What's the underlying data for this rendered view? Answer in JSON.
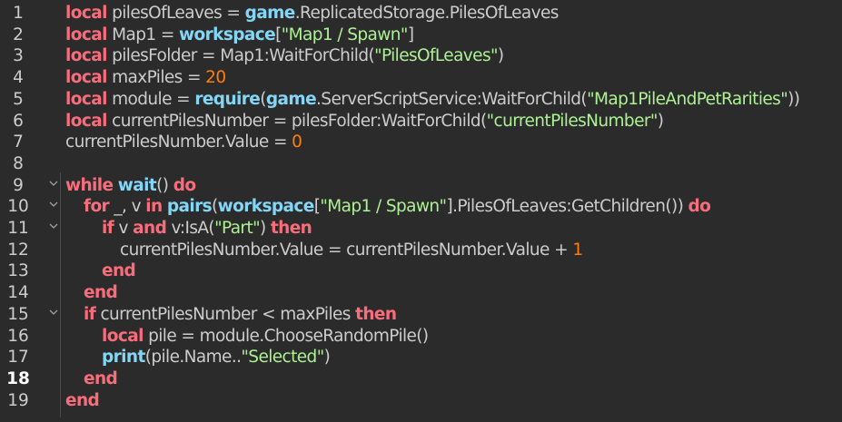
{
  "editor": {
    "current_line": 18,
    "colors": {
      "background": "#2b2b2b",
      "keyword": "#f86d7c",
      "builtin": "#84d6f7",
      "string": "#adf195",
      "number": "#ff7d0e",
      "text": "#cccccc"
    },
    "fold_icon": "chevron-down-icon",
    "lines": [
      {
        "num": "1",
        "indent": 0,
        "tokens": [
          [
            "kw",
            "local"
          ],
          [
            "id",
            " pilesOfLeaves = "
          ],
          [
            "bi",
            "game"
          ],
          [
            "id",
            ".ReplicatedStorage.PilesOfLeaves"
          ]
        ]
      },
      {
        "num": "2",
        "indent": 0,
        "tokens": [
          [
            "kw",
            "local"
          ],
          [
            "id",
            " Map1 = "
          ],
          [
            "bi",
            "workspace"
          ],
          [
            "id",
            "["
          ],
          [
            "str",
            "\"Map1 / Spawn\""
          ],
          [
            "id",
            "]"
          ]
        ]
      },
      {
        "num": "3",
        "indent": 0,
        "tokens": [
          [
            "kw",
            "local"
          ],
          [
            "id",
            " pilesFolder = Map1:WaitForChild("
          ],
          [
            "str",
            "\"PilesOfLeaves\""
          ],
          [
            "id",
            ")"
          ]
        ]
      },
      {
        "num": "4",
        "indent": 0,
        "tokens": [
          [
            "kw",
            "local"
          ],
          [
            "id",
            " maxPiles = "
          ],
          [
            "num",
            "20"
          ]
        ]
      },
      {
        "num": "5",
        "indent": 0,
        "tokens": [
          [
            "kw",
            "local"
          ],
          [
            "id",
            " module = "
          ],
          [
            "bi",
            "require"
          ],
          [
            "id",
            "("
          ],
          [
            "bi",
            "game"
          ],
          [
            "id",
            ".ServerScriptService:WaitForChild("
          ],
          [
            "str",
            "\"Map1PileAndPetRarities\""
          ],
          [
            "id",
            "))"
          ]
        ]
      },
      {
        "num": "6",
        "indent": 0,
        "tokens": [
          [
            "kw",
            "local"
          ],
          [
            "id",
            " currentPilesNumber = pilesFolder:WaitForChild("
          ],
          [
            "str",
            "\"currentPilesNumber\""
          ],
          [
            "id",
            ")"
          ]
        ]
      },
      {
        "num": "7",
        "indent": 0,
        "tokens": [
          [
            "id",
            "currentPilesNumber.Value = "
          ],
          [
            "num",
            "0"
          ]
        ]
      },
      {
        "num": "8",
        "indent": 0,
        "tokens": []
      },
      {
        "num": "9",
        "indent": 0,
        "fold": true,
        "tokens": [
          [
            "kw",
            "while"
          ],
          [
            "id",
            " "
          ],
          [
            "bi",
            "wait"
          ],
          [
            "id",
            "() "
          ],
          [
            "kw",
            "do"
          ]
        ]
      },
      {
        "num": "10",
        "indent": 1,
        "fold": true,
        "tokens": [
          [
            "kw",
            "for"
          ],
          [
            "id",
            " _, v "
          ],
          [
            "kw",
            "in"
          ],
          [
            "id",
            " "
          ],
          [
            "bi",
            "pairs"
          ],
          [
            "id",
            "("
          ],
          [
            "bi",
            "workspace"
          ],
          [
            "id",
            "["
          ],
          [
            "str",
            "\"Map1 / Spawn\""
          ],
          [
            "id",
            "].PilesOfLeaves:GetChildren()) "
          ],
          [
            "kw",
            "do"
          ]
        ]
      },
      {
        "num": "11",
        "indent": 2,
        "fold": true,
        "tokens": [
          [
            "kw",
            "if"
          ],
          [
            "id",
            " v "
          ],
          [
            "kw",
            "and"
          ],
          [
            "id",
            " v:IsA("
          ],
          [
            "str",
            "\"Part\""
          ],
          [
            "id",
            ") "
          ],
          [
            "kw",
            "then"
          ]
        ]
      },
      {
        "num": "12",
        "indent": 3,
        "tokens": [
          [
            "id",
            "currentPilesNumber.Value = currentPilesNumber.Value + "
          ],
          [
            "num",
            "1"
          ]
        ]
      },
      {
        "num": "13",
        "indent": 2,
        "tokens": [
          [
            "kw",
            "end"
          ]
        ]
      },
      {
        "num": "14",
        "indent": 1,
        "tokens": [
          [
            "kw",
            "end"
          ]
        ]
      },
      {
        "num": "15",
        "indent": 1,
        "fold": true,
        "tokens": [
          [
            "kw",
            "if"
          ],
          [
            "id",
            " currentPilesNumber < maxPiles "
          ],
          [
            "kw",
            "then"
          ]
        ]
      },
      {
        "num": "16",
        "indent": 2,
        "tokens": [
          [
            "kw",
            "local"
          ],
          [
            "id",
            " pile = module.ChooseRandomPile()"
          ]
        ]
      },
      {
        "num": "17",
        "indent": 2,
        "tokens": [
          [
            "bi",
            "print"
          ],
          [
            "id",
            "(pile.Name.."
          ],
          [
            "str",
            "\"Selected\""
          ],
          [
            "id",
            ")"
          ]
        ]
      },
      {
        "num": "18",
        "indent": 1,
        "tokens": [
          [
            "kw",
            "end"
          ]
        ]
      },
      {
        "num": "19",
        "indent": 0,
        "tokens": [
          [
            "kw",
            "end"
          ]
        ]
      }
    ]
  }
}
